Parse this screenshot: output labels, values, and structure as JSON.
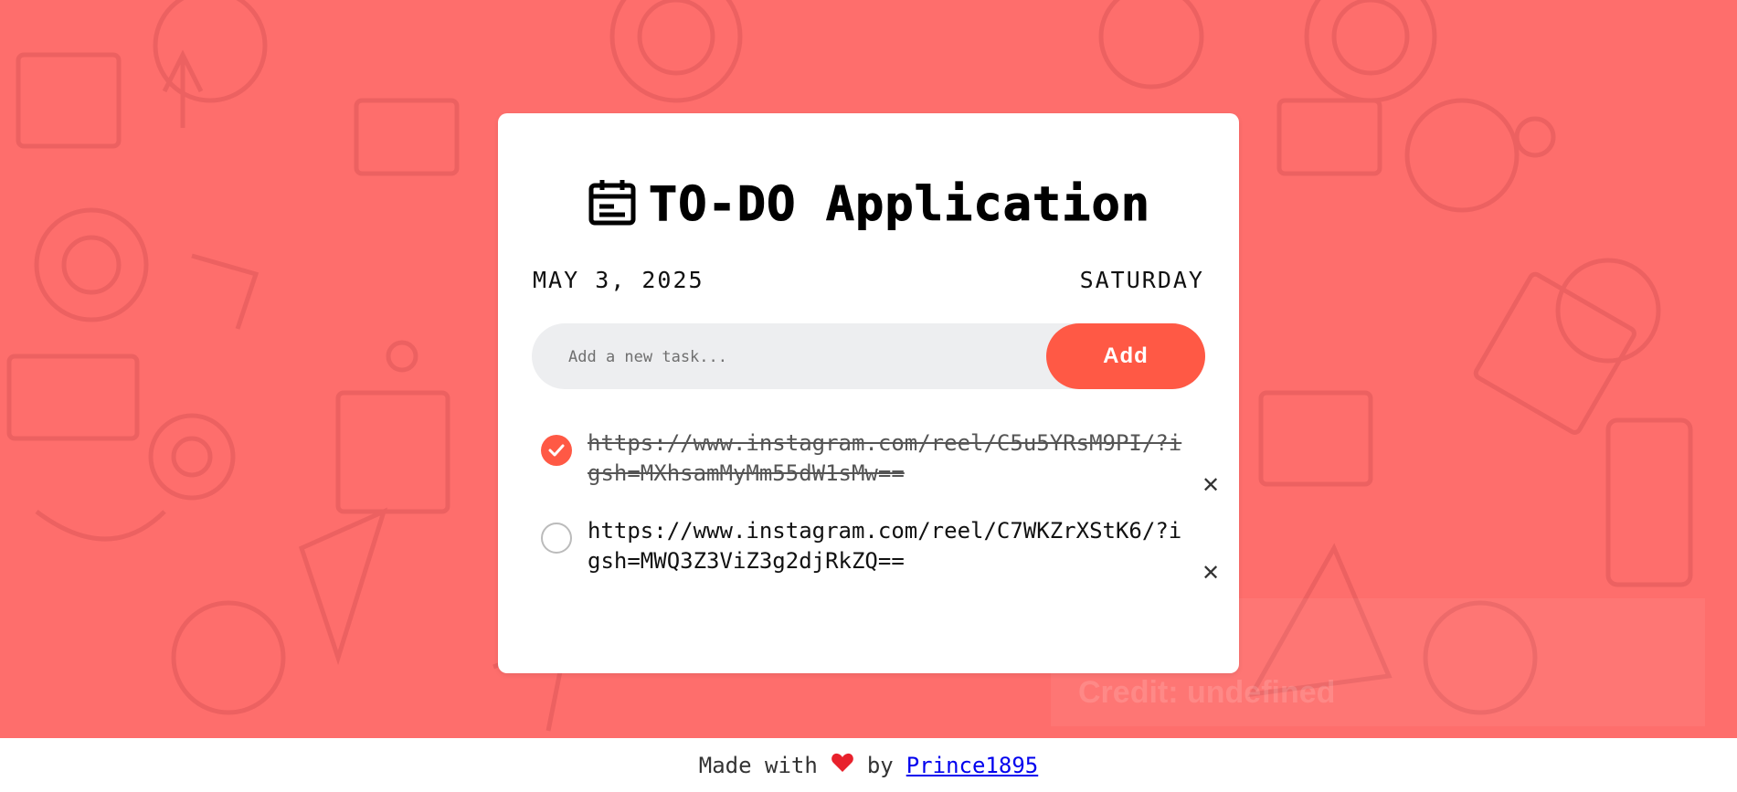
{
  "app": {
    "title": "TO-DO Application"
  },
  "date": {
    "full": "MAY 3, 2025",
    "weekday": "SATURDAY"
  },
  "new_task": {
    "placeholder": "Add a new task...",
    "value": ""
  },
  "add_button": {
    "label": "Add"
  },
  "tasks": [
    {
      "text": "https://www.instagram.com/reel/C5u5YRsM9PI/?igsh=MXhsamMyMm55dW1sMw==",
      "completed": true,
      "remove_label": "✕"
    },
    {
      "text": "https://www.instagram.com/reel/C7WKZrXStK6/?igsh=MWQ3Z3ViZ3g2djRkZQ==",
      "completed": false,
      "remove_label": "✕"
    }
  ],
  "credit": {
    "text": "Credit: undefined"
  },
  "footer": {
    "prefix": "Made with",
    "suffix": "by",
    "author": "Prince1895"
  },
  "colors": {
    "background": "#fe6e6c",
    "accent": "#ff5945",
    "input_bg": "#edeef0"
  },
  "icons": {
    "title": "calendar-icon",
    "heart": "heart-icon",
    "check": "check-icon",
    "remove": "close-icon"
  }
}
